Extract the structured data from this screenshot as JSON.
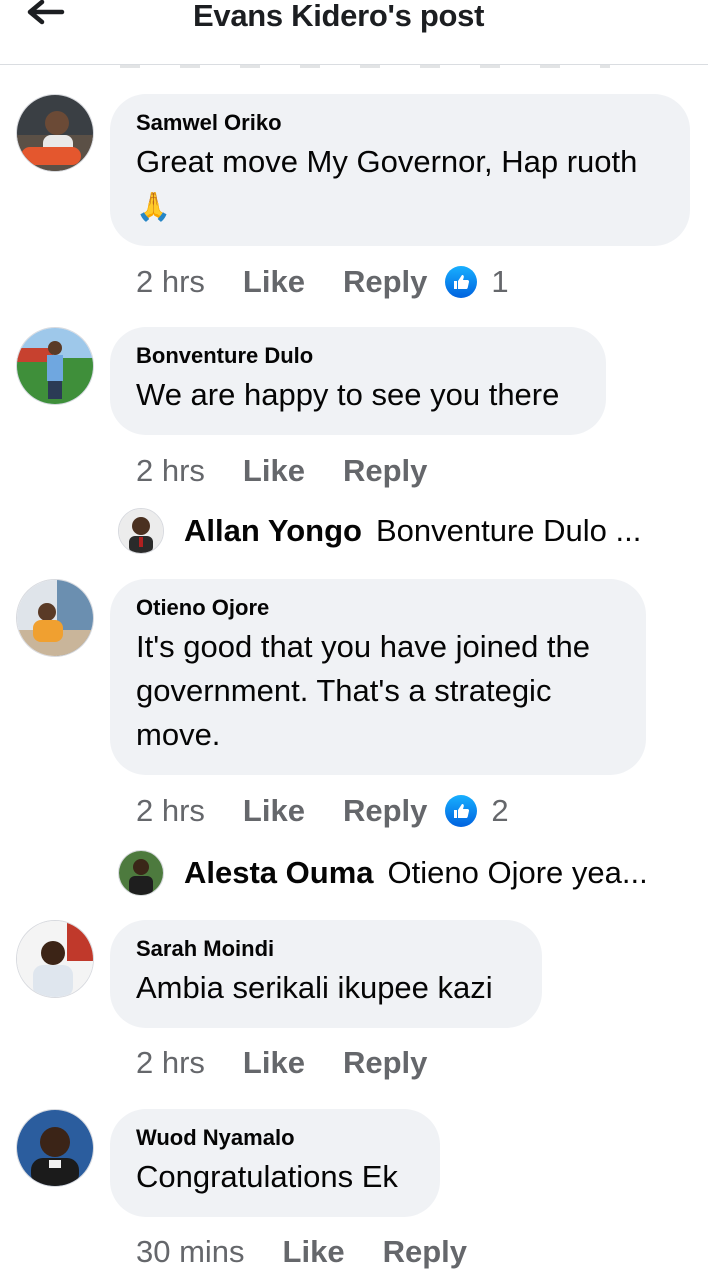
{
  "header": {
    "title": "Evans Kidero's post",
    "back_icon": "arrow-left-icon"
  },
  "comments": [
    {
      "author": "Samwel Oriko",
      "text": "Great move My Governor, Hap ruoth",
      "emoji": "🙏",
      "time": "2 hrs",
      "like": "Like",
      "reply": "Reply",
      "reactions": "1"
    },
    {
      "author": "Bonventure Dulo",
      "text": "We are happy to see you there",
      "time": "2 hrs",
      "like": "Like",
      "reply": "Reply"
    },
    {
      "author": "Otieno Ojore",
      "text": "It's good that you have joined the government. That's a strategic move.",
      "time": "2 hrs",
      "like": "Like",
      "reply": "Reply",
      "reactions": "2"
    },
    {
      "author": "Sarah Moindi",
      "text": "Ambia serikali ikupee kazi",
      "time": "2 hrs",
      "like": "Like",
      "reply": "Reply"
    },
    {
      "author": "Wuod Nyamalo",
      "text": "Congratulations Ek",
      "time": "30 mins",
      "like": "Like",
      "reply": "Reply"
    }
  ],
  "replies": [
    {
      "author": "Allan Yongo",
      "text": "Bonventure Dulo ..."
    },
    {
      "author": "Alesta Ouma",
      "text": "Otieno Ojore yea..."
    }
  ],
  "colors": {
    "bubble": "#f0f2f5",
    "meta": "#65676b",
    "like_blue": "#1877f2"
  }
}
